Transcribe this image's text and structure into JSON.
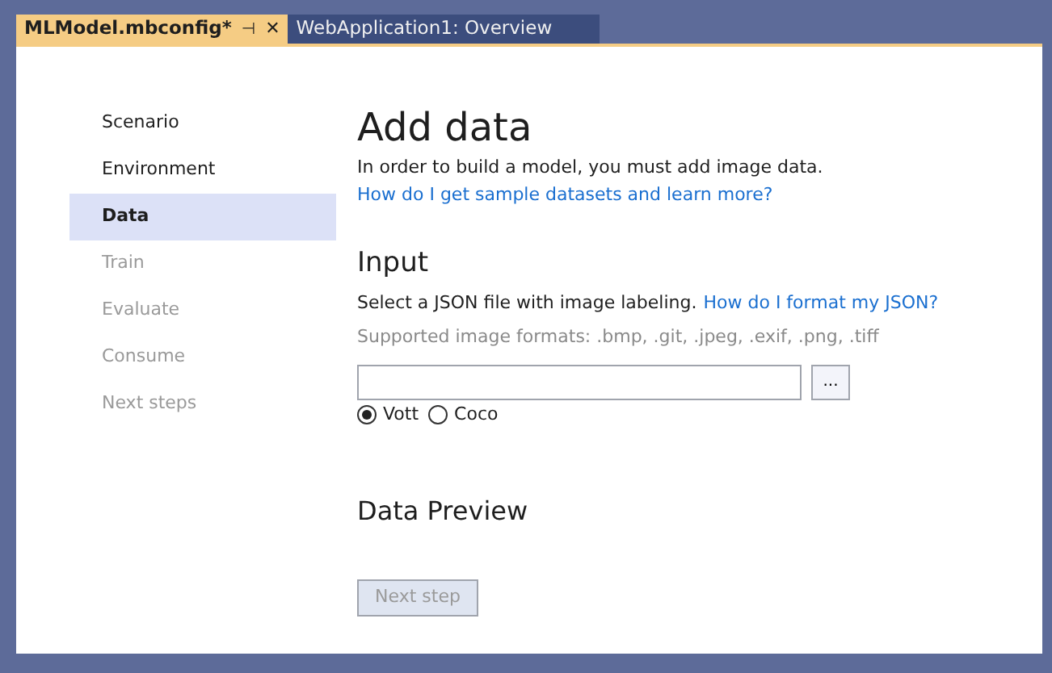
{
  "tabs": [
    {
      "label": "MLModel.mbconfig*",
      "selected": true,
      "pin": "⊣",
      "close": "✕"
    },
    {
      "label": "WebApplication1: Overview",
      "selected": false
    }
  ],
  "sidebar": {
    "items": [
      {
        "label": "Scenario",
        "selected": false,
        "disabled": false
      },
      {
        "label": "Environment",
        "selected": false,
        "disabled": false
      },
      {
        "label": "Data",
        "selected": true,
        "disabled": false
      },
      {
        "label": "Train",
        "selected": false,
        "disabled": true
      },
      {
        "label": "Evaluate",
        "selected": false,
        "disabled": true
      },
      {
        "label": "Consume",
        "selected": false,
        "disabled": true
      },
      {
        "label": "Next steps",
        "selected": false,
        "disabled": true
      }
    ]
  },
  "heading": "Add data",
  "intro": "In order to build a model, you must add image data.",
  "intro_link": "How do I get sample datasets and learn more?",
  "input": {
    "heading": "Input",
    "description": "Select a JSON file with image labeling.",
    "help_link": "How do I format my JSON?",
    "formats": "Supported image formats: .bmp, .git, .jpeg, .exif, .png, .tiff",
    "browse": "...",
    "options": [
      {
        "label": "Vott",
        "selected": true
      },
      {
        "label": "Coco",
        "selected": false
      }
    ]
  },
  "preview_heading": "Data Preview",
  "next_button": {
    "label": "Next step",
    "disabled": true
  }
}
